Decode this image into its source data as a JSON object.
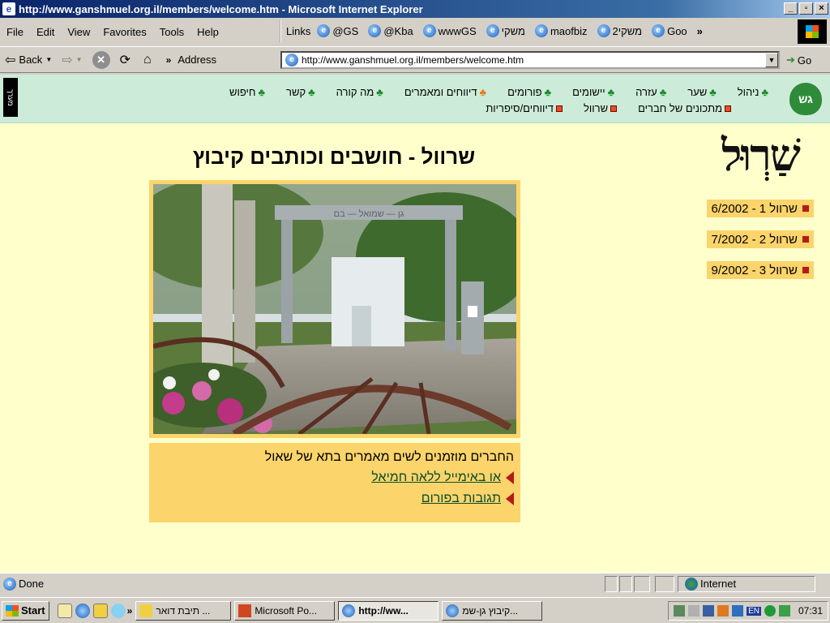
{
  "window": {
    "title": "http://www.ganshmuel.org.il/members/welcome.htm - Microsoft Internet Explorer",
    "controls": [
      "_",
      "×"
    ]
  },
  "menubar": {
    "items": [
      "File",
      "Edit",
      "View",
      "Favorites",
      "Tools",
      "Help"
    ]
  },
  "links_bar": {
    "label": "Links",
    "items": [
      "@GS",
      "@Kba",
      "wwwGS",
      "משקי",
      "maofbiz",
      "משקי2",
      "Goo"
    ],
    "chevron": "»"
  },
  "navbar": {
    "back": "Back",
    "address_label": "Address",
    "url": "http://www.ganshmuel.org.il/members/welcome.htm",
    "go": "Go"
  },
  "site": {
    "vertical_tab": "מערך",
    "logo_text": "גש",
    "menu_row1": [
      "חיפוש",
      "קשר",
      "מה קורה",
      "דיווחים ומאמרים",
      "פורומים",
      "יישומים",
      "עזרה",
      "שער",
      "ניהול"
    ],
    "menu_row2": [
      "דיווחים/סיפריות",
      "שרוול",
      "מתכונים של חברים"
    ],
    "brand": "שַׁרְוּל",
    "title": "שרוול - חושבים וכותבים קיבוץ",
    "caption_text": "החברים מוזמנים לשים מאמרים בתא של שאול",
    "caption_link1": "או באימייל ללאה חמיאל",
    "caption_link2": "תגובות בפורום",
    "issues": [
      "שרוול 1 - 6/2002",
      "שרוול 2 - 7/2002",
      "שרוול 3 - 9/2002"
    ]
  },
  "status": {
    "left": "Done",
    "zone": "Internet"
  },
  "taskbar": {
    "start": "Start",
    "tasks": [
      "תיבת דואר ...",
      "Microsoft Po...",
      "http://ww...",
      "קיבוץ גן-שמ..."
    ],
    "clock": "07:31",
    "lang": "EN"
  },
  "colors": {
    "page_bg": "#ffffcc",
    "site_bar": "#ccecd9",
    "accent_yellow": "#fbd46b",
    "title_bar": "#0a246a"
  }
}
